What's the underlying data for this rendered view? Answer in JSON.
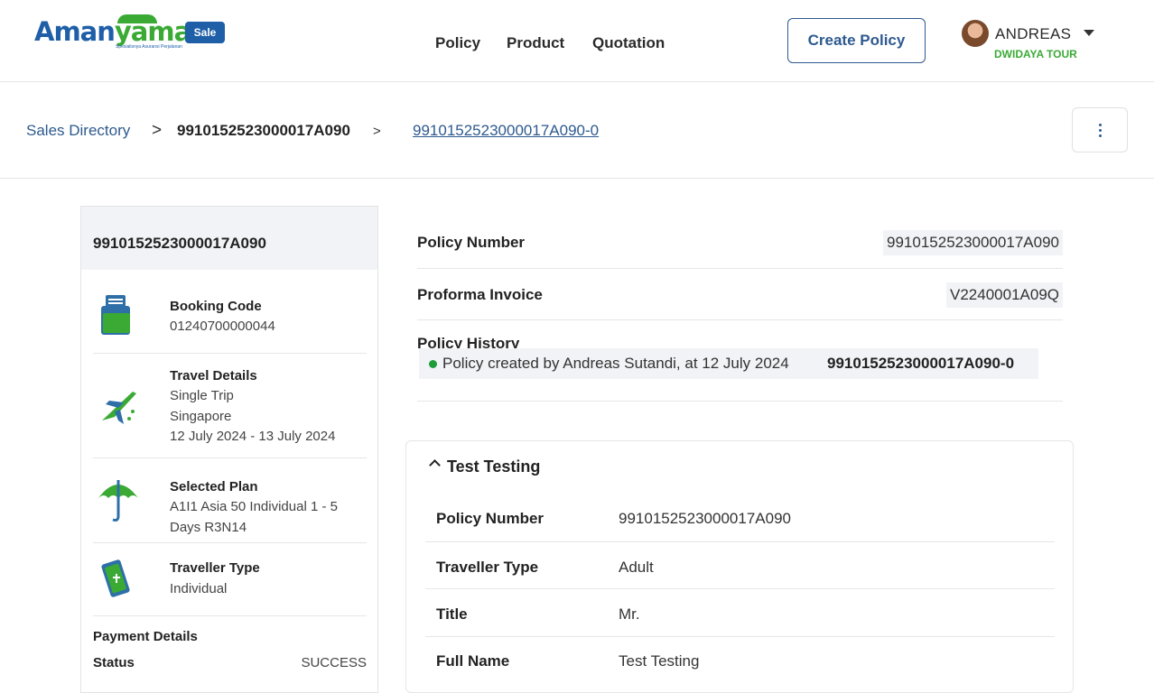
{
  "brand": {
    "logo_text_a": "Aman",
    "logo_text_b": "yaman",
    "tagline": "Spesialisnya Asuransi Perjalanan",
    "badge": "Sale"
  },
  "nav": {
    "policy": "Policy",
    "product": "Product",
    "quotation": "Quotation"
  },
  "header": {
    "create_policy": "Create Policy"
  },
  "user": {
    "name": "ANDREAS",
    "org": "DWIDAYA TOUR"
  },
  "breadcrumb": {
    "root": "Sales Directory",
    "sep1": ">",
    "policy": "9910152523000017A090",
    "sep2": ">",
    "current": "9910152523000017A090-0"
  },
  "summary": {
    "title": "9910152523000017A090",
    "booking": {
      "title": "Booking Code",
      "value": "01240700000044"
    },
    "travel": {
      "title": "Travel Details",
      "type": "Single Trip",
      "destination": "Singapore",
      "dates": "12 July 2024 - 13 July 2024"
    },
    "plan": {
      "title": "Selected Plan",
      "line1": "A1I1 Asia 50 Individual 1 - 5",
      "line2": "Days R3N14"
    },
    "traveller": {
      "title": "Traveller Type",
      "value": "Individual"
    },
    "payment": {
      "title": "Payment Details",
      "status_label": "Status",
      "status_value": "SUCCESS"
    }
  },
  "details": {
    "policy_number_label": "Policy Number",
    "policy_number_value": "9910152523000017A090",
    "proforma_label": "Proforma Invoice",
    "proforma_value": "V2240001A09Q",
    "history_label": "Policy History",
    "history_text": "Policy created by Andreas Sutandi, at 12 July 2024",
    "history_ref": "9910152523000017A090-0"
  },
  "traveller_card": {
    "name": "Test Testing",
    "rows": [
      {
        "label": "Policy Number",
        "value": "9910152523000017A090"
      },
      {
        "label": "Traveller Type",
        "value": "Adult"
      },
      {
        "label": "Title",
        "value": "Mr."
      },
      {
        "label": "Full Name",
        "value": "Test Testing"
      }
    ]
  },
  "colors": {
    "primary": "#2e5a8f",
    "brand_green": "#3aaa35",
    "success_dot": "#1e9c3a",
    "panel_bg": "#f1f3f6"
  },
  "icons": [
    "folder-icon",
    "airplane-icon",
    "umbrella-icon",
    "ticket-icon",
    "chevron-up-icon",
    "more-vertical-icon",
    "caret-down-icon"
  ]
}
